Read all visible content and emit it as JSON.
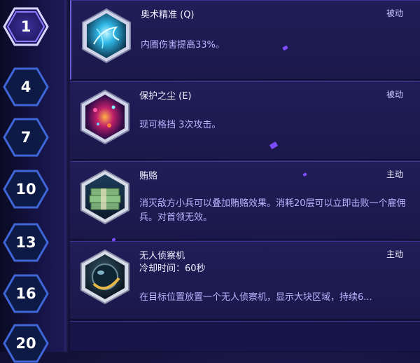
{
  "tiers": [
    "1",
    "4",
    "7",
    "10",
    "13",
    "16",
    "20"
  ],
  "selected_tier": "1",
  "talents": [
    {
      "name": "奥术精准 (Q)",
      "type": "被动",
      "description": "内圈伤害提高33%。",
      "icon": "arcane-precision-icon"
    },
    {
      "name": "保护之尘 (E)",
      "type": "被动",
      "description": "现可格挡 3次攻击。",
      "icon": "protective-dust-icon"
    },
    {
      "name": "贿赂",
      "type": "主动",
      "description": "消灭敌方小兵可以叠加贿赂效果。消耗20层可以立即击败一个雇佣兵。对首领无效。",
      "icon": "bribe-icon"
    },
    {
      "name": "无人侦察机",
      "type": "主动",
      "cooldown": "冷却时间：60秒",
      "description": "在目标位置放置一个无人侦察机，显示大块区域，持续6...",
      "icon": "scouting-drone-icon"
    }
  ],
  "colors": {
    "rail_bg": "#17154a",
    "card_bg": "#201d58",
    "selected_hex": "#7b6cff",
    "hex_border": "#3f66d6",
    "desc_text": "#b7b6ff"
  }
}
